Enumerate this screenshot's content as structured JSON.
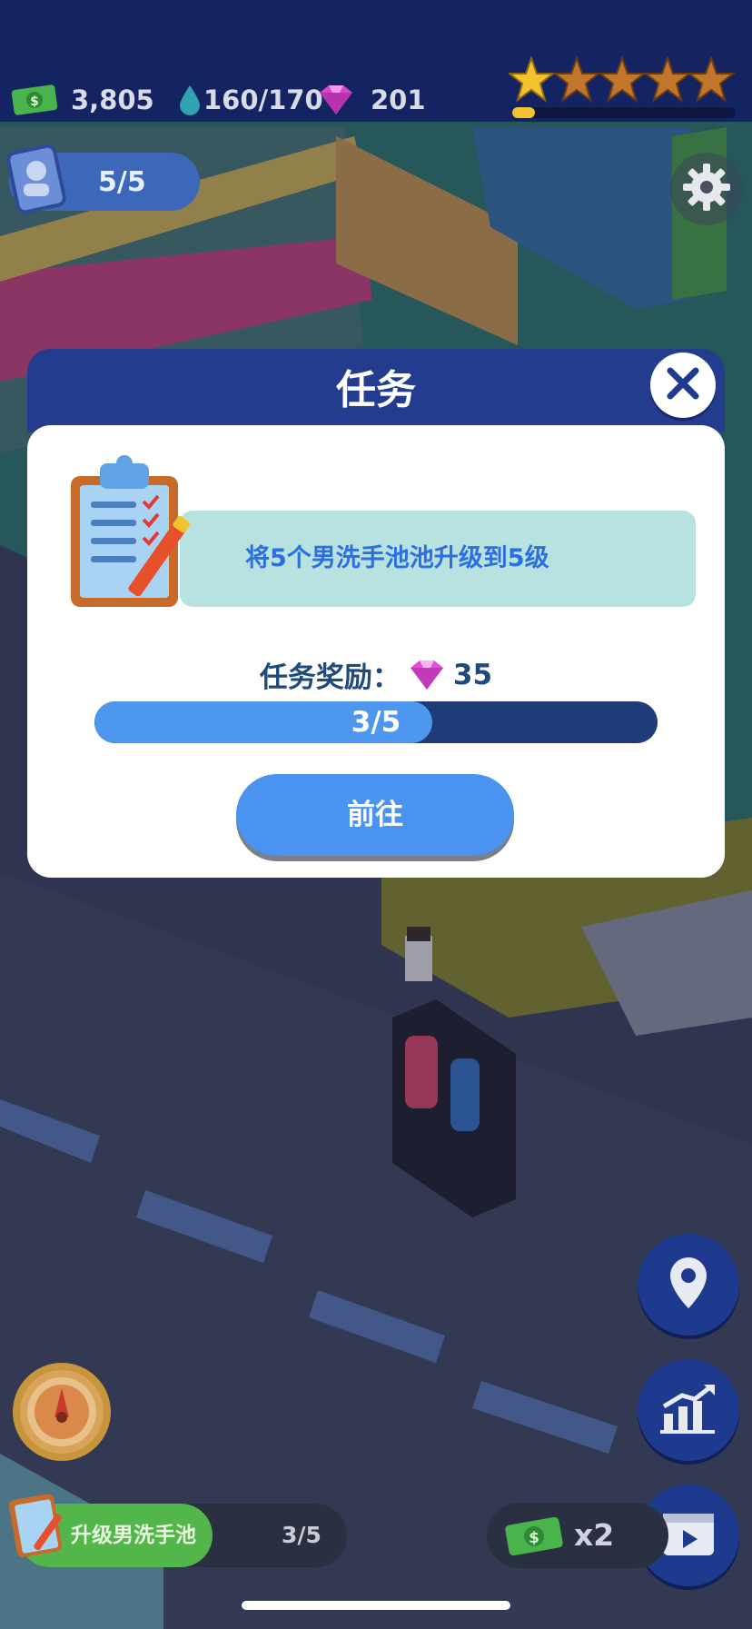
{
  "top_bar": {
    "cash": "3,805",
    "water": "160/170",
    "gems": "201",
    "star_rating": 1,
    "star_total": 5,
    "star_progress_fraction": 0.1
  },
  "staff": {
    "count": "5/5"
  },
  "modal": {
    "title": "任务",
    "task_text": "将5个男洗手池池升级到5级",
    "reward_label": "任务奖励：",
    "reward_amount": "35",
    "progress_text": "3/5",
    "progress_fraction": 0.6,
    "go_button": "前往"
  },
  "quest_bar": {
    "label": "升级男洗手池",
    "count": "3/5"
  },
  "multiplier": {
    "label": "x2"
  },
  "icons": {
    "cash": "cash-icon",
    "water": "water-drop-icon",
    "gem": "gem-icon",
    "settings": "gear-icon",
    "close": "close-icon",
    "location": "location-pin-icon",
    "stats": "stats-chart-icon",
    "video": "video-icon"
  },
  "colors": {
    "topbar": "#142462",
    "modal_header": "#233c8e",
    "accent_blue": "#4a93f0",
    "task_bg": "#b7e2e0",
    "quest_green": "#52b64a"
  }
}
